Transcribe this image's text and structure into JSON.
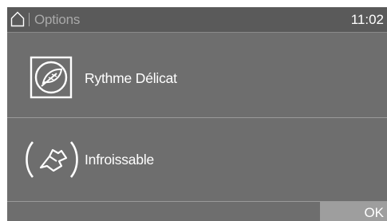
{
  "header": {
    "home_icon": "home-icon",
    "breadcrumb": "Options",
    "time": "11:02"
  },
  "options": [
    {
      "icon": "delicate-rhythm-icon",
      "label": "Rythme Délicat"
    },
    {
      "icon": "anti-crease-icon",
      "label": "Infroissable"
    }
  ],
  "footer": {
    "ok_label": "OK"
  },
  "colors": {
    "screen_bg": "#6e6e6e",
    "header_bg": "#5a5a5a",
    "ok_bg": "#9e9e9e",
    "text": "#ffffff"
  }
}
